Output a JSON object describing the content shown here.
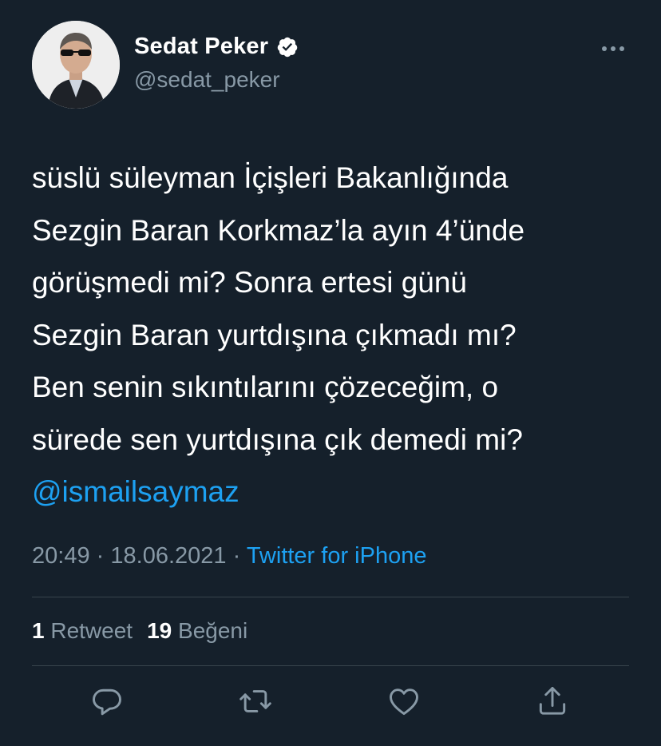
{
  "author": {
    "display_name": "Sedat Peker",
    "handle": "@sedat_peker",
    "verified": true
  },
  "icons": {
    "verified": "verified-badge-icon",
    "more": "more-options-icon",
    "reply": "reply-icon",
    "retweet": "retweet-icon",
    "like": "like-icon",
    "share": "share-icon"
  },
  "tweet": {
    "lines": [
      "süslü süleyman İçişleri Bakanlığında",
      "Sezgin Baran Korkmaz’la ayın 4’ünde",
      "görüşmedi mi? Sonra ertesi günü",
      "Sezgin Baran yurtdışına çıkmadı mı?",
      "Ben senin sıkıntılarını çözeceğim,  o",
      "sürede sen yurtdışına çık demedi mi?"
    ],
    "mention": "@ismailsaymaz",
    "time": "20:49",
    "separator": "·",
    "date": "18.06.2021",
    "source": "Twitter for iPhone"
  },
  "stats": {
    "retweet_count": "1",
    "retweet_label": "Retweet",
    "like_count": "19",
    "like_label": "Beğeni"
  },
  "colors": {
    "background": "#15202b",
    "text": "#ffffff",
    "secondary": "#8899a6",
    "accent": "#1da1f2",
    "divider": "#38444d"
  }
}
